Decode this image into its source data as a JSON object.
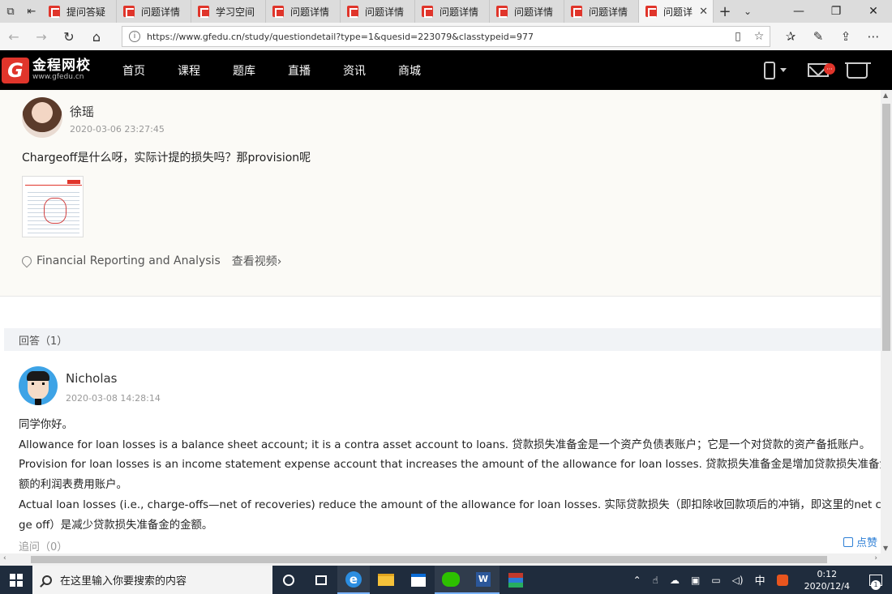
{
  "browser": {
    "tabs": [
      {
        "label": "提问答疑",
        "active": false
      },
      {
        "label": "问题详情",
        "active": false
      },
      {
        "label": "学习空间",
        "active": false
      },
      {
        "label": "问题详情",
        "active": false
      },
      {
        "label": "问题详情",
        "active": false
      },
      {
        "label": "问题详情",
        "active": false
      },
      {
        "label": "问题详情",
        "active": false
      },
      {
        "label": "问题详情",
        "active": false
      },
      {
        "label": "问题详",
        "active": true
      }
    ],
    "url": "https://www.gfedu.cn/study/questiondetail?type=1&quesid=223079&classtypeid=977"
  },
  "site": {
    "logo_cn": "金程网校",
    "logo_en": "www.gfedu.cn",
    "logo_mark": "G",
    "menu": [
      "首页",
      "课程",
      "题库",
      "直播",
      "资讯",
      "商城"
    ],
    "mail_badge": "···"
  },
  "question": {
    "user": "徐瑶",
    "time": "2020-03-06 23:27:45",
    "text": "Chargeoff是什么呀，实际计提的损失吗？那provision呢",
    "course": "Financial Reporting and Analysis",
    "video_link": "查看视频›"
  },
  "answers_header": "回答（1）",
  "answer": {
    "user": "Nicholas",
    "time": "2020-03-08 14:28:14",
    "lines": [
      "同学你好。",
      "Allowance for loan losses is a balance sheet account; it is a contra asset account to loans. 贷款损失准备金是一个资产负债表账户；它是一个对贷款的资产备抵账户。",
      "Provision for loan losses is an income statement expense account that increases the amount of the allowance for loan losses.  贷款损失准备金是增加贷款损失准备金金",
      "额的利润表费用账户。",
      "Actual loan losses (i.e., charge-offs—net of recoveries) reduce the amount of the allowance for loan losses. 实际贷款损失（即扣除收回款项后的冲销，即这里的net char",
      "ge off）是减少贷款损失准备金的金额。"
    ],
    "followup": "追问（0）",
    "like": "点赞"
  },
  "taskbar": {
    "search_placeholder": "在这里输入你要搜索的内容",
    "ime": "中",
    "clock_time": "0:12",
    "clock_date": "2020/12/4",
    "notif_count": "1"
  },
  "colors": {
    "brand_red": "#e0352b",
    "link_blue": "#2d7fd6",
    "taskbar": "#1f2c3d"
  }
}
